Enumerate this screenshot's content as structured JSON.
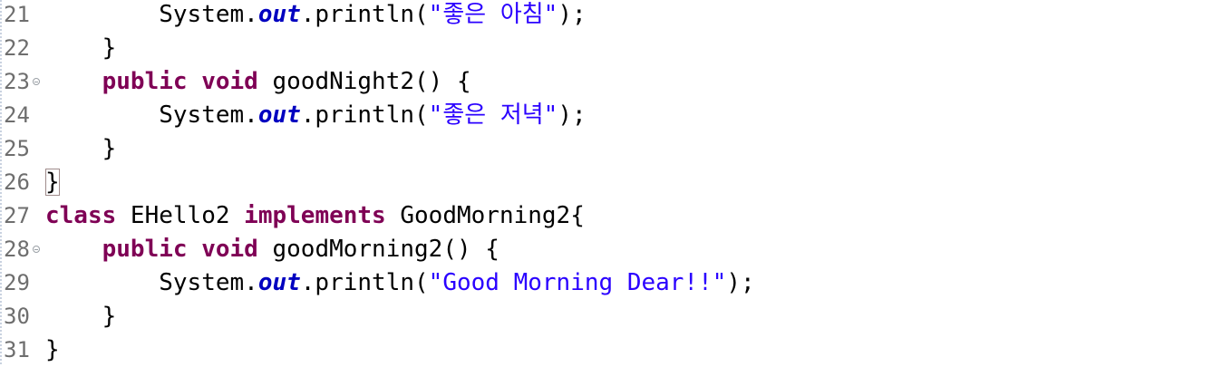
{
  "editor": {
    "lines": [
      {
        "num": "21",
        "fold": false,
        "indent": "        ",
        "tokens": [
          {
            "t": "System.",
            "c": "plain"
          },
          {
            "t": "out",
            "c": "fld"
          },
          {
            "t": ".println(",
            "c": "plain"
          },
          {
            "t": "\"좋은 아침\"",
            "c": "str"
          },
          {
            "t": ");",
            "c": "plain"
          }
        ]
      },
      {
        "num": "22",
        "fold": false,
        "indent": "    ",
        "tokens": [
          {
            "t": "}",
            "c": "plain"
          }
        ]
      },
      {
        "num": "23",
        "fold": true,
        "indent": "    ",
        "tokens": [
          {
            "t": "public",
            "c": "kw"
          },
          {
            "t": " ",
            "c": "plain"
          },
          {
            "t": "void",
            "c": "kw"
          },
          {
            "t": " goodNight2() {",
            "c": "plain"
          }
        ]
      },
      {
        "num": "24",
        "fold": false,
        "indent": "        ",
        "tokens": [
          {
            "t": "System.",
            "c": "plain"
          },
          {
            "t": "out",
            "c": "fld"
          },
          {
            "t": ".println(",
            "c": "plain"
          },
          {
            "t": "\"좋은 저녁\"",
            "c": "str"
          },
          {
            "t": ");",
            "c": "plain"
          }
        ]
      },
      {
        "num": "25",
        "fold": false,
        "indent": "    ",
        "tokens": [
          {
            "t": "}",
            "c": "plain"
          }
        ]
      },
      {
        "num": "26",
        "fold": false,
        "indent": "",
        "tokens": [
          {
            "t": "}",
            "c": "bracket"
          }
        ]
      },
      {
        "num": "27",
        "fold": false,
        "indent": "",
        "tokens": [
          {
            "t": "class",
            "c": "kw"
          },
          {
            "t": " EHello2 ",
            "c": "plain"
          },
          {
            "t": "implements",
            "c": "kw"
          },
          {
            "t": " GoodMorning2{",
            "c": "plain"
          }
        ]
      },
      {
        "num": "28",
        "fold": true,
        "indent": "    ",
        "tokens": [
          {
            "t": "public",
            "c": "kw"
          },
          {
            "t": " ",
            "c": "plain"
          },
          {
            "t": "void",
            "c": "kw"
          },
          {
            "t": " goodMorning2() {",
            "c": "plain"
          }
        ]
      },
      {
        "num": "29",
        "fold": false,
        "indent": "        ",
        "tokens": [
          {
            "t": "System.",
            "c": "plain"
          },
          {
            "t": "out",
            "c": "fld"
          },
          {
            "t": ".println(",
            "c": "plain"
          },
          {
            "t": "\"Good Morning Dear!!\"",
            "c": "str"
          },
          {
            "t": ");",
            "c": "plain"
          }
        ]
      },
      {
        "num": "30",
        "fold": false,
        "indent": "    ",
        "tokens": [
          {
            "t": "}",
            "c": "plain"
          }
        ]
      },
      {
        "num": "31",
        "fold": false,
        "indent": "",
        "tokens": [
          {
            "t": "}",
            "c": "plain"
          }
        ]
      }
    ]
  },
  "colors": {
    "keyword": "#7f0055",
    "field": "#0000c0",
    "string": "#2a00ff",
    "line_number": "#6e6e6e"
  },
  "icons": {
    "fold": "collapse-circle-icon"
  }
}
